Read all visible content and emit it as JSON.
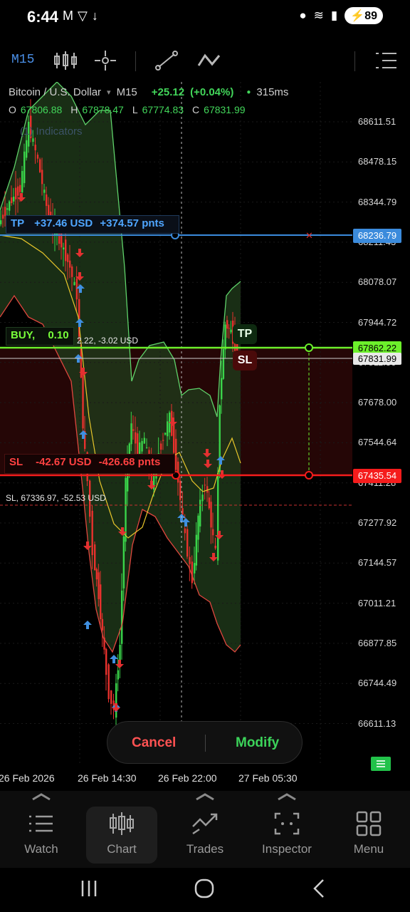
{
  "status": {
    "time": "6:44",
    "battery": "89"
  },
  "toolbar": {
    "timeframe": "M15"
  },
  "chart_header": {
    "symbol": "Bitcoin / U.S. Dollar",
    "timeframe": "M15",
    "change": "+25.12",
    "change_pct": "(+0.04%)",
    "latency": "315ms",
    "open_label": "O",
    "open": "67806.88",
    "high_label": "H",
    "high": "67878.47",
    "low_label": "L",
    "low": "67774.83",
    "close_label": "C",
    "close": "67831.99",
    "indicators": "(1) Indicators"
  },
  "price_axis": {
    "ticks": [
      "68611.51",
      "68478.15",
      "68344.79",
      "68211.43",
      "68078.07",
      "67944.72",
      "67811.36",
      "67678.00",
      "67544.64",
      "67411.28",
      "67277.92",
      "67144.57",
      "67011.21",
      "66877.85",
      "66744.49",
      "66611.13"
    ],
    "tp_tag": "68236.79",
    "bid_tag": "67862.22",
    "ask_tag": "67831.99",
    "sl_tag": "67435.54"
  },
  "orders": {
    "tp_label": "TP",
    "tp_usd": "+37.46 USD",
    "tp_pnts": "+374.57 pnts",
    "buy_label": "BUY,",
    "buy_volume": "0.10",
    "buy_pnl": "2.22,  -3.02 USD",
    "sl_label": "SL",
    "sl_usd": "-42.67 USD",
    "sl_pnts": "-426.68 pnts",
    "old_sl": "SL,  67336.97,  -52.53 USD",
    "tp_badge": "TP",
    "sl_badge": "SL"
  },
  "actions": {
    "cancel": "Cancel",
    "modify": "Modify"
  },
  "time_axis": [
    "26 Feb 2026",
    "26 Feb 14:30",
    "26 Feb 22:00",
    "27 Feb 05:30"
  ],
  "nav": {
    "items": [
      {
        "label": "Watch",
        "icon": "watch-list-icon"
      },
      {
        "label": "Chart",
        "icon": "candlestick-icon"
      },
      {
        "label": "Trades",
        "icon": "trades-icon"
      },
      {
        "label": "Inspector",
        "icon": "inspector-icon"
      },
      {
        "label": "Menu",
        "icon": "grid-menu-icon"
      }
    ]
  },
  "colors": {
    "bull": "#3ad44a",
    "bear": "#e8312d",
    "tp_line": "#3b8bdc",
    "bid_line": "#6cf02b",
    "sl_line": "#f51c1c",
    "band_upper": "#5fd26a",
    "band_lower": "#e0473e",
    "ma": "#e8c62b"
  }
}
